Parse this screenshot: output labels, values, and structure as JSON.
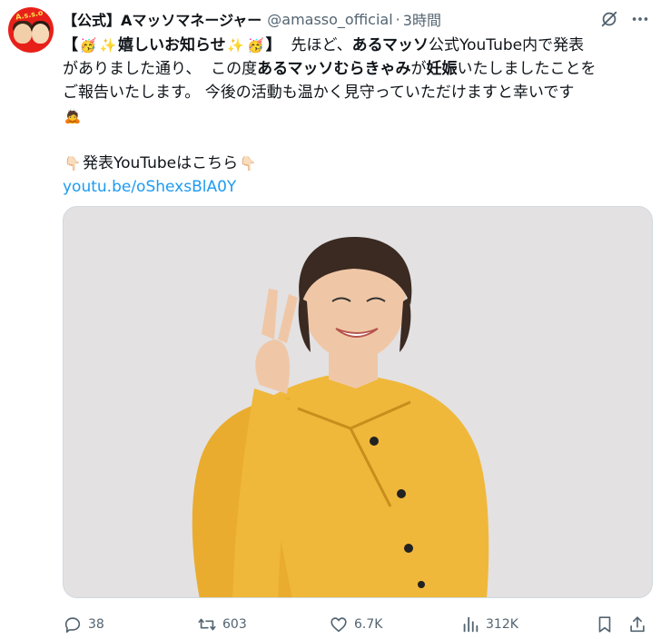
{
  "author": {
    "display_name": "【公式】Aマッソマネージャー",
    "handle": "@amasso_official",
    "separator": "·",
    "timestamp": "3時間",
    "avatar_logo": "A.s.s.o"
  },
  "tweet": {
    "line1_open": "【",
    "line1_emoji_1": "🥳",
    "line1_emoji_2": "✨",
    "line1_announce": "嬉しいお知らせ",
    "line1_emoji_3": "✨",
    "line1_emoji_4": "🥳",
    "line1_close": "】",
    "line1_text_a": "先ほど、",
    "line1_bold_a": "あるマッソ",
    "line1_text_b": "公式YouTube内で発表",
    "line2_text_a": "がありました通り、",
    "line2_text_b": "この度",
    "line2_bold_a": "あるマッソむらきゃみ",
    "line2_text_c": "が",
    "line2_bold_b": "妊娠",
    "line2_text_d": "いたしましたことを",
    "line3_text": "ご報告いたします。 今後の活動も温かく見守っていただけますと幸いです",
    "line4_emoji": "🙇",
    "line5_emoji_left": "👇🏻",
    "line5_text": "発表YouTubeはこちら",
    "line5_emoji_right": "👇🏻",
    "link": "youtu.be/oShexsBlA0Y"
  },
  "media": {
    "background_color": "#e3e1e2",
    "shirt_color": "#efb83a",
    "hair_color": "#3a2a22",
    "skin_color": "#f0c7a6"
  },
  "actions": {
    "replies": "38",
    "reposts": "603",
    "likes": "6.7K",
    "views": "312K"
  },
  "icons": [
    "grok-icon",
    "more-icon",
    "reply-icon",
    "repost-icon",
    "like-icon",
    "views-icon",
    "bookmark-icon",
    "share-icon"
  ],
  "colors": {
    "text_primary": "#0f1419",
    "text_secondary": "#536471",
    "link": "#1d9bf0"
  }
}
